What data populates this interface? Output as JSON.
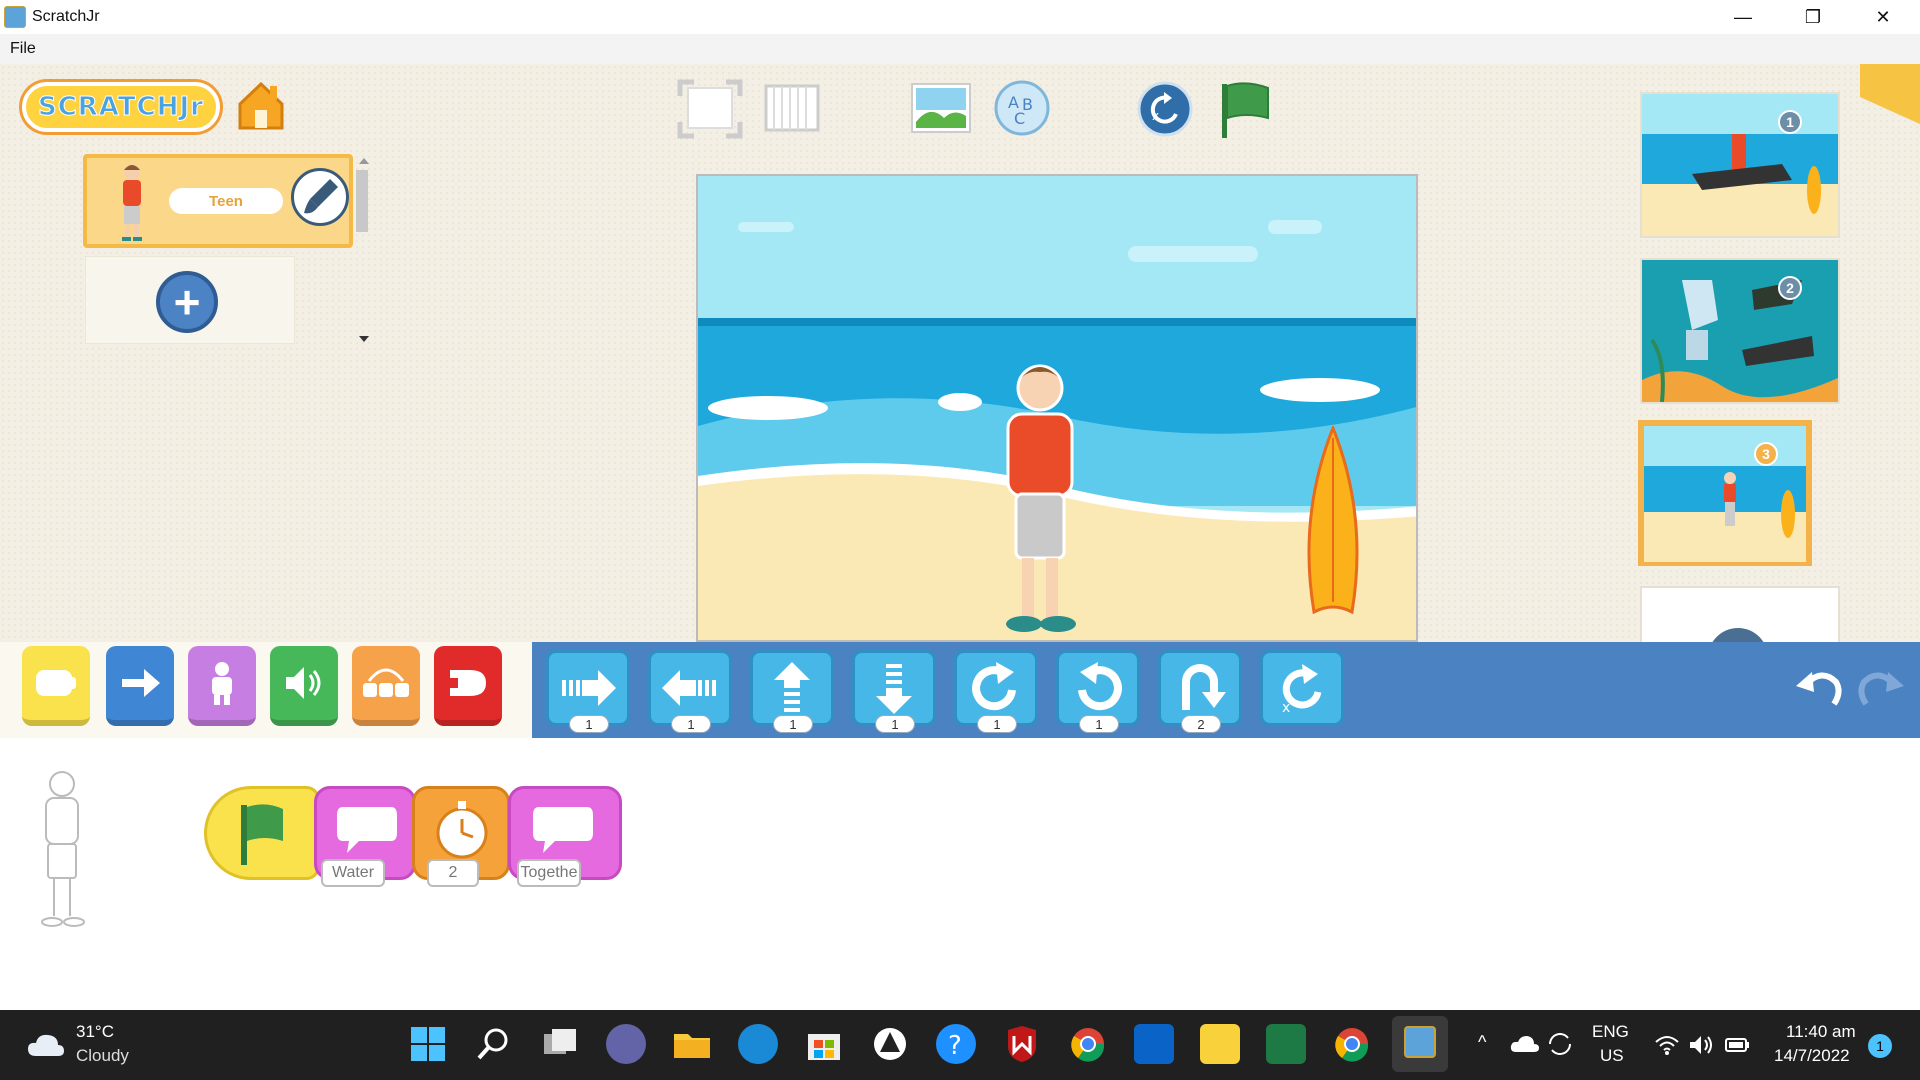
{
  "window": {
    "title": "ScratchJr",
    "minimize": "—",
    "maximize": "❐",
    "close": "✕"
  },
  "menu": {
    "file": "File"
  },
  "logo": "SCRATCHJr",
  "sprite": {
    "name": "Teen",
    "add": "+"
  },
  "stage_tools": [
    "full-screen",
    "grid",
    "change-background",
    "add-text",
    "reset-characters",
    "green-flag"
  ],
  "pages": [
    {
      "number": "1"
    },
    {
      "number": "2"
    },
    {
      "number": "3"
    }
  ],
  "categories": [
    "triggering",
    "motion",
    "looks",
    "sound",
    "control",
    "end"
  ],
  "motion_blocks": [
    {
      "name": "move-right",
      "value": "1"
    },
    {
      "name": "move-left",
      "value": "1"
    },
    {
      "name": "move-up",
      "value": "1"
    },
    {
      "name": "move-down",
      "value": "1"
    },
    {
      "name": "turn-right",
      "value": "1"
    },
    {
      "name": "turn-left",
      "value": "1"
    },
    {
      "name": "hop",
      "value": "2"
    },
    {
      "name": "go-home",
      "value": ""
    }
  ],
  "script": {
    "say1": "Water",
    "wait": "2",
    "say2": "Togethe"
  },
  "colors": {
    "accent": "#4b82c2",
    "stage_sky": "#a4e8f5",
    "sea": "#1fa7dc",
    "sand": "#fbe9b5"
  },
  "taskbar": {
    "temp": "31°C",
    "weather": "Cloudy",
    "lang1": "ENG",
    "lang2": "US",
    "time": "11:40 am",
    "date": "14/7/2022",
    "notif": "1"
  }
}
